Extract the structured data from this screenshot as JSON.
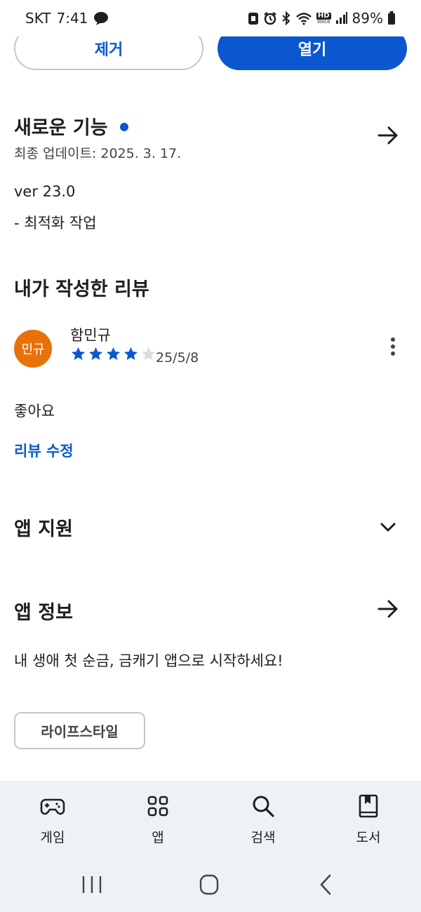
{
  "status_bar": {
    "carrier": "SKT",
    "time": "7:41",
    "hd_label": "HD",
    "voice_label": "Voice",
    "battery": "89%"
  },
  "actions": {
    "remove_label": "제거",
    "open_label": "열기"
  },
  "whats_new": {
    "title": "새로운 기능",
    "updated": "최종 업데이트: 2025. 3. 17.",
    "version": "ver 23.0",
    "change": "- 최적화 작업"
  },
  "my_review": {
    "title": "내가 작성한 리뷰",
    "avatar_text": "민규",
    "reviewer": "함민규",
    "rating": 4,
    "max_rating": 5,
    "date": "25/5/8",
    "body": "좋아요",
    "edit_label": "리뷰 수정"
  },
  "app_support": {
    "title": "앱 지원"
  },
  "app_info": {
    "title": "앱 정보",
    "description": "내 생애 첫 순금, 금캐기 앱으로 시작하세요!",
    "category": "라이프스타일"
  },
  "bottom_nav": {
    "items": [
      {
        "label": "게임",
        "icon": "gamepad-icon"
      },
      {
        "label": "앱",
        "icon": "apps-grid-icon"
      },
      {
        "label": "검색",
        "icon": "search-icon"
      },
      {
        "label": "도서",
        "icon": "book-icon"
      }
    ]
  },
  "colors": {
    "accent": "#0b57d0",
    "avatar_bg": "#e8710a",
    "nav_bg": "#eef2f7",
    "star_empty": "#dadce0"
  }
}
